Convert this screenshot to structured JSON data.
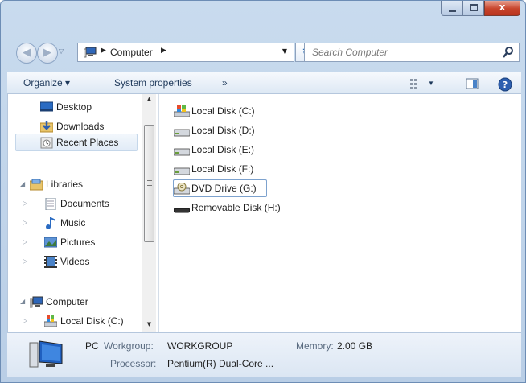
{
  "window": {
    "close_glyph": "x"
  },
  "address_bar": {
    "crumbs": [
      "Computer"
    ],
    "icon": "computer-icon"
  },
  "search": {
    "placeholder": "Search Computer"
  },
  "command_bar": {
    "organize": "Organize ▾",
    "system_properties": "System properties",
    "more": "»",
    "view_options_icon": "view-options-icon",
    "preview_pane_icon": "preview-pane-icon",
    "help_icon": "help-icon"
  },
  "nav_pane": {
    "favorites": [
      {
        "label": "Desktop",
        "icon": "desktop-icon"
      },
      {
        "label": "Downloads",
        "icon": "downloads-icon"
      },
      {
        "label": "Recent Places",
        "icon": "recent-places-icon",
        "selected": true
      }
    ],
    "libraries": {
      "label": "Libraries",
      "items": [
        {
          "label": "Documents",
          "icon": "documents-icon"
        },
        {
          "label": "Music",
          "icon": "music-icon"
        },
        {
          "label": "Pictures",
          "icon": "pictures-icon"
        },
        {
          "label": "Videos",
          "icon": "videos-icon"
        }
      ]
    },
    "computer": {
      "label": "Computer",
      "items": [
        {
          "label": "Local Disk (C:)",
          "icon": "system-drive-icon"
        }
      ]
    }
  },
  "drives": [
    {
      "label": "Local Disk (C:)",
      "icon": "system-drive-icon"
    },
    {
      "label": "Local Disk (D:)",
      "icon": "hard-drive-icon"
    },
    {
      "label": "Local Disk (E:)",
      "icon": "hard-drive-icon"
    },
    {
      "label": "Local Disk (F:)",
      "icon": "hard-drive-icon"
    },
    {
      "label": "DVD Drive (G:)",
      "icon": "dvd-drive-icon",
      "focused": true
    },
    {
      "label": "Removable Disk (H:)",
      "icon": "removable-disk-icon"
    }
  ],
  "details": {
    "name": "PC",
    "workgroup_key": "Workgroup:",
    "workgroup_value": "WORKGROUP",
    "memory_key": "Memory:",
    "memory_value": "2.00 GB",
    "processor_key": "Processor:",
    "processor_value": "Pentium(R) Dual-Core  ..."
  }
}
